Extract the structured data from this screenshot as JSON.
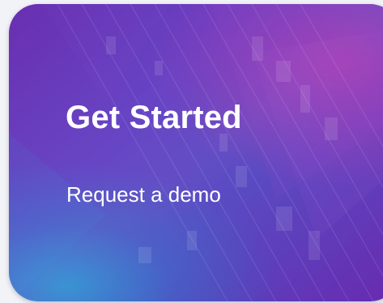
{
  "card": {
    "title": "Get Started",
    "link_label": "Request a demo"
  },
  "colors": {
    "page_background": "#f2f3f6",
    "card_gradient_purple": "#6a2fb1",
    "card_gradient_blue": "#1e96d2",
    "card_gradient_magenta": "#aa28aa",
    "text": "#ffffff"
  }
}
